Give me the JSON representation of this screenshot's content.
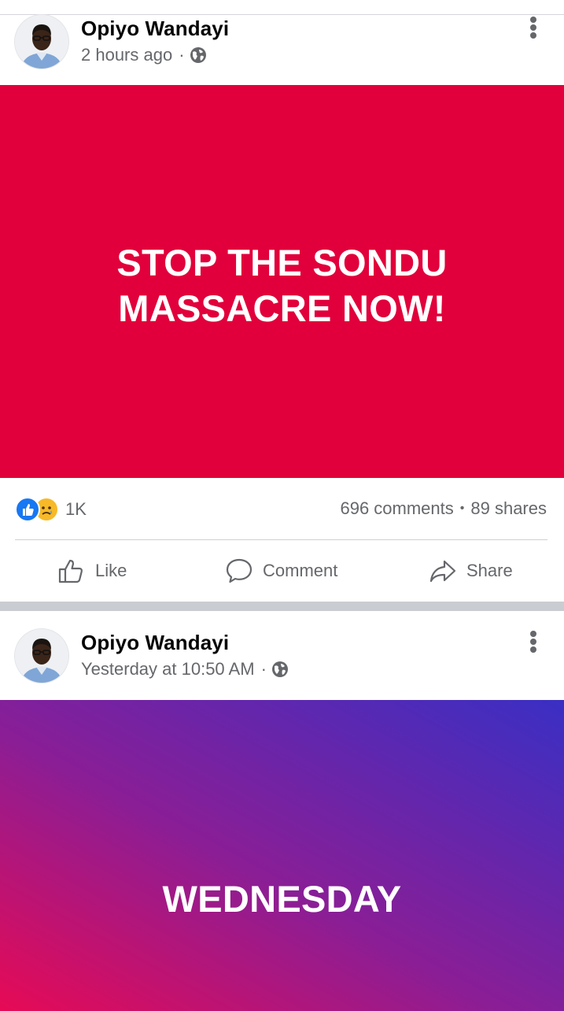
{
  "posts": [
    {
      "author": "Opiyo Wandayi",
      "time": "2 hours ago",
      "separator": "·",
      "privacy_icon": "globe-icon",
      "banner_text": "STOP THE SONDU MASSACRE NOW!",
      "banner_color": "#e1003b",
      "reactions": {
        "icons": [
          "like-reaction-icon",
          "sad-reaction-icon"
        ],
        "count": "1K"
      },
      "comments": "696 comments",
      "stat_separator": "•",
      "shares": "89 shares",
      "actions": {
        "like": "Like",
        "comment": "Comment",
        "share": "Share"
      }
    },
    {
      "author": "Opiyo Wandayi",
      "time": "Yesterday at 10:50 AM",
      "separator": "·",
      "privacy_icon": "globe-icon",
      "banner_text": "WEDNESDAY",
      "banner_gradient": [
        "#e70a55",
        "#8a1e96",
        "#3a2fc4"
      ]
    }
  ],
  "colors": {
    "like_blue": "#1877f2",
    "sad_yellow": "#f7b928",
    "secondary_text": "#65676b",
    "feed_gap": "#c9ccd1"
  }
}
